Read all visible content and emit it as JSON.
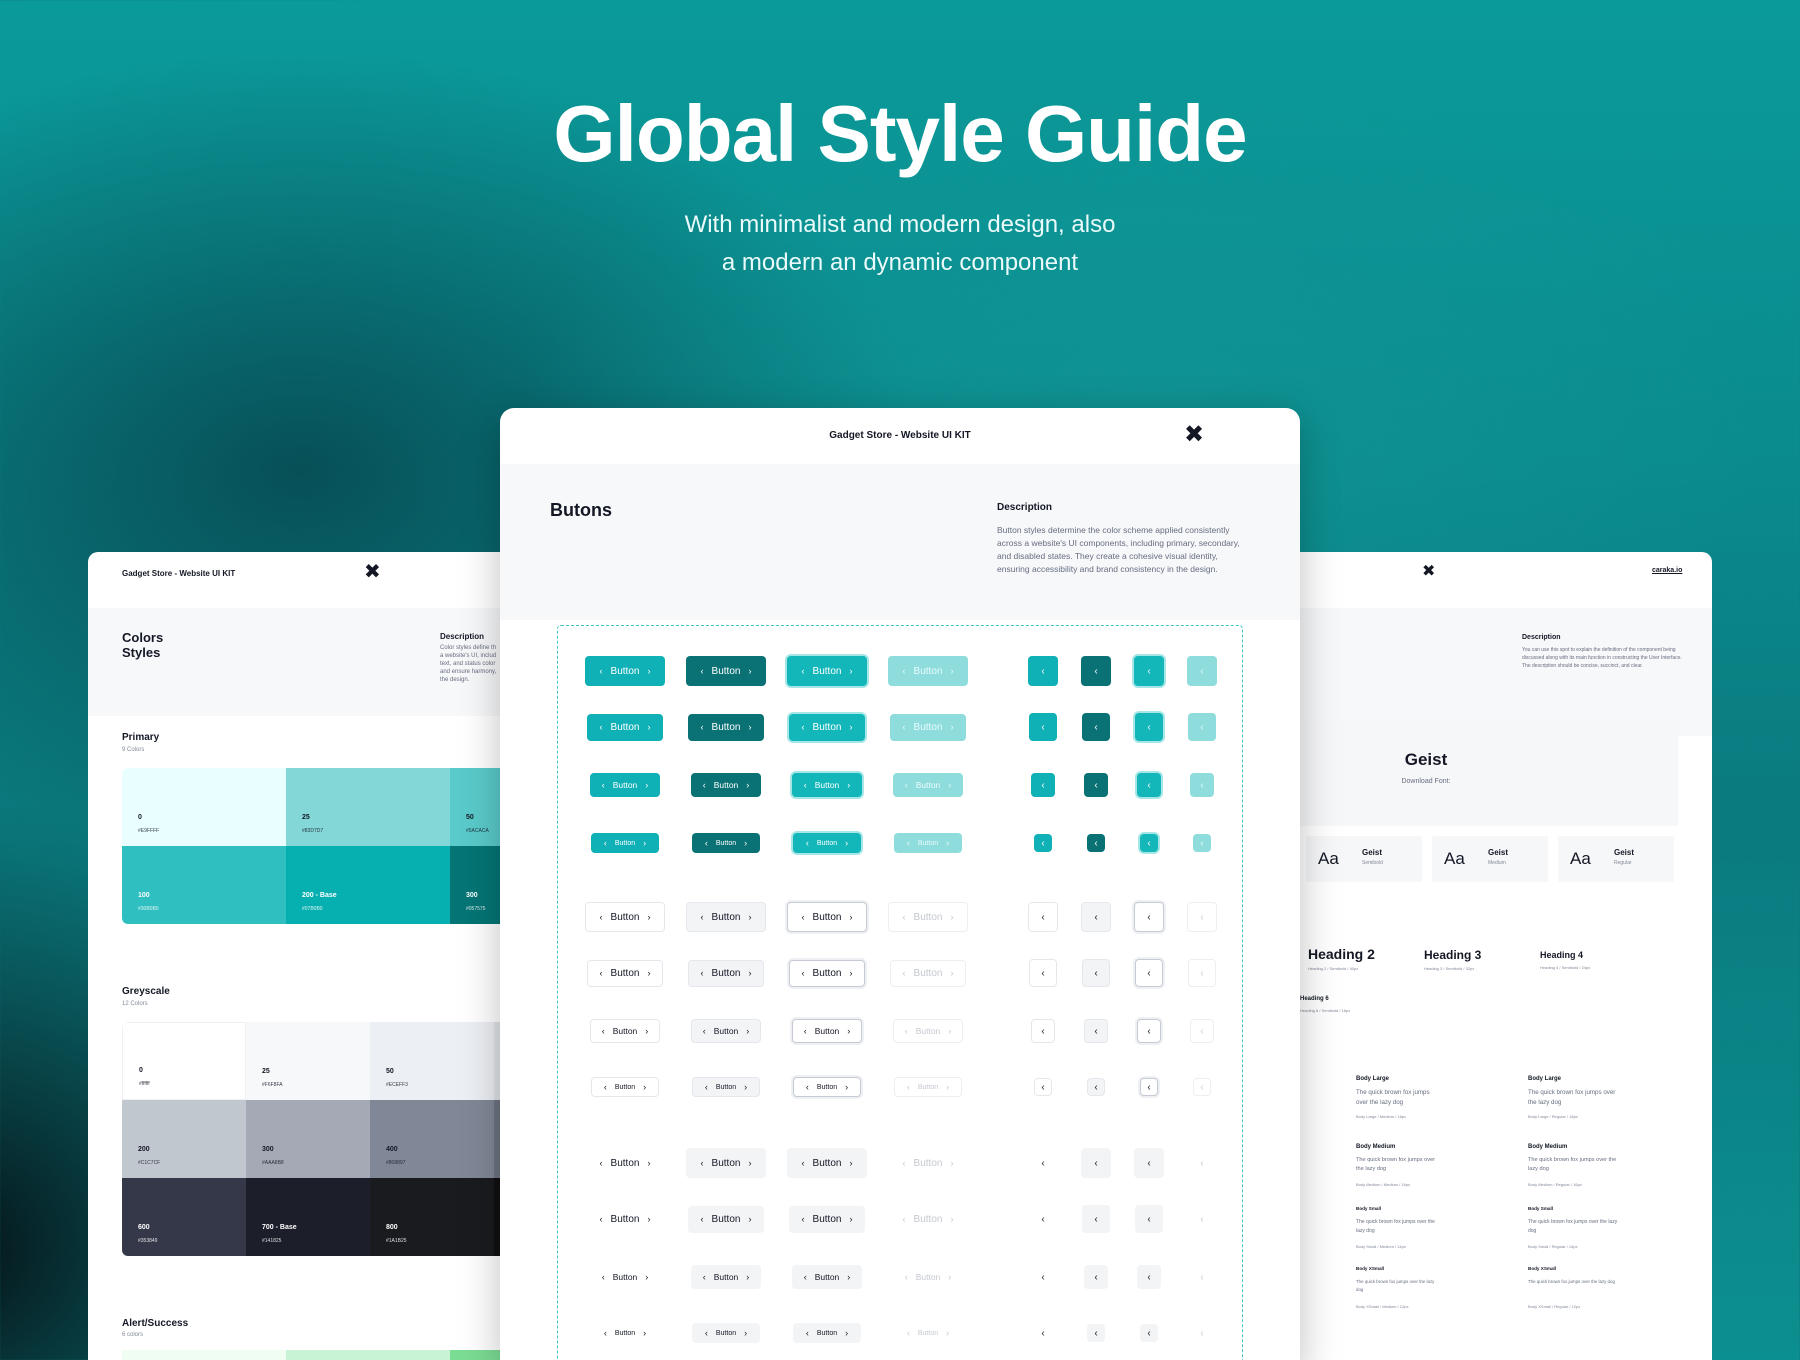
{
  "hero": {
    "title": "Global Style Guide",
    "subtitle_line1": "With minimalist and modern design, also",
    "subtitle_line2": "a modern an dynamic component"
  },
  "brand": "Gadget Store - Website UI KIT",
  "logo_glyph": "✖",
  "description_label": "Description",
  "center": {
    "section_title": "Butons",
    "description": "Button styles determine the color scheme applied consistently across a website's UI components, including primary, secondary, and disabled states. They create a cohesive visual identity, ensuring accessibility and brand consistency in the design.",
    "button_label": "Button",
    "chev_left": "‹",
    "chev_right": "›"
  },
  "left": {
    "section_title_1": "Colors",
    "section_title_2": "Styles",
    "description": "Color styles define th a website's UI, includ text, and status color and ensure harmony, the design.",
    "primary": {
      "label": "Primary",
      "count": "9 Colors",
      "swatches": [
        {
          "name": "0",
          "hex": "#E9FFFF",
          "color": "#e9ffff",
          "text": "#141825"
        },
        {
          "name": "25",
          "hex": "#83D7D7",
          "color": "#83d7d7",
          "text": "#141825"
        },
        {
          "name": "50",
          "hex": "#5ACACA",
          "color": "#5acaca",
          "text": "#141825"
        },
        {
          "name": "100",
          "hex": "#30B0B0",
          "color": "#30bfc0",
          "text": "#ffffff"
        },
        {
          "name": "200 - Base",
          "hex": "#07B0B0",
          "color": "#07b0b0",
          "text": "#ffffff"
        },
        {
          "name": "300",
          "hex": "#057575",
          "color": "#057575",
          "text": "#ffffff"
        }
      ]
    },
    "greyscale": {
      "label": "Greyscale",
      "count": "12 Colors",
      "swatches": [
        {
          "name": "0",
          "hex": "#ffffff",
          "color": "#ffffff",
          "text": "#141825"
        },
        {
          "name": "25",
          "hex": "#F6F8FA",
          "color": "#f6f8fa",
          "text": "#141825"
        },
        {
          "name": "50",
          "hex": "#ECEFF3",
          "color": "#eceff3",
          "text": "#141825"
        },
        {
          "name": "200",
          "hex": "#C1C7CF",
          "color": "#c1c7cf",
          "text": "#141825"
        },
        {
          "name": "300",
          "hex": "#AAA8B8",
          "color": "#a4a9b5",
          "text": "#141825"
        },
        {
          "name": "400",
          "hex": "#808897",
          "color": "#808897",
          "text": "#141825"
        },
        {
          "name": "600",
          "hex": "#353849",
          "color": "#353849",
          "text": "#ffffff"
        },
        {
          "name": "700 - Base",
          "hex": "#141825",
          "color": "#1c1f2a",
          "text": "#ffffff"
        },
        {
          "name": "800",
          "hex": "#1A1B25",
          "color": "#1a1b1e",
          "text": "#ffffff"
        }
      ]
    },
    "alert": {
      "label": "Alert/Success",
      "count": "6 colors"
    }
  },
  "right": {
    "link": "caraka.io",
    "description": "You can use this spot to explain the definition of the component being discussed along with its main function in constructing the User Interface. The description should be concise, succinct, and clear.",
    "font_name": "Geist",
    "download": "Download Font:",
    "weights": [
      {
        "aa": "Aa",
        "name": "Geist",
        "weight": "Semibold"
      },
      {
        "aa": "Aa",
        "name": "Geist",
        "weight": "Medium"
      },
      {
        "aa": "Aa",
        "name": "Geist",
        "weight": "Regular"
      }
    ],
    "headings": [
      {
        "title": "Heading 2",
        "spec": "Heading 2 / Semibold / 40px"
      },
      {
        "title": "Heading 3",
        "spec": "Heading 3 / Semibold / 32px"
      },
      {
        "title": "Heading 4",
        "spec": "Heading 4 / Semibold / 24px"
      },
      {
        "title": "Heading 6",
        "spec": "Heading 6 / Semibold / 16px"
      }
    ],
    "body_left": [
      {
        "label": "Body Large",
        "text": "The quick brown fox jumps over the lazy dog",
        "spec": "Body Large / Medium / 18px"
      },
      {
        "label": "Body Medium",
        "text": "The quick brown fox jumps over the lazy dog",
        "spec": "Body Medium / Medium / 16px"
      },
      {
        "label": "Body Small",
        "text": "The quick brown fox jumps over the lazy dog",
        "spec": "Body Small / Medium / 14px"
      },
      {
        "label": "Body XSmall",
        "text": "The quick brown fox jumps over the lazy dog",
        "spec": "Body XSmall / Medium / 12px"
      }
    ],
    "body_right": [
      {
        "label": "Body Large",
        "text": "The quick brown fox jumps over the lazy dog",
        "spec": "Body Large / Regular / 18px"
      },
      {
        "label": "Body Medium",
        "text": "The quick brown fox jumps over the lazy dog",
        "spec": "Body Medium / Regular / 16px"
      },
      {
        "label": "Body Small",
        "text": "The quick brown fox jumps over the lazy dog",
        "spec": "Body Small / Regular / 14px"
      },
      {
        "label": "Body XSmall",
        "text": "The quick brown fox jumps over the lazy dog",
        "spec": "Body XSmall / Regular / 12px"
      }
    ]
  }
}
